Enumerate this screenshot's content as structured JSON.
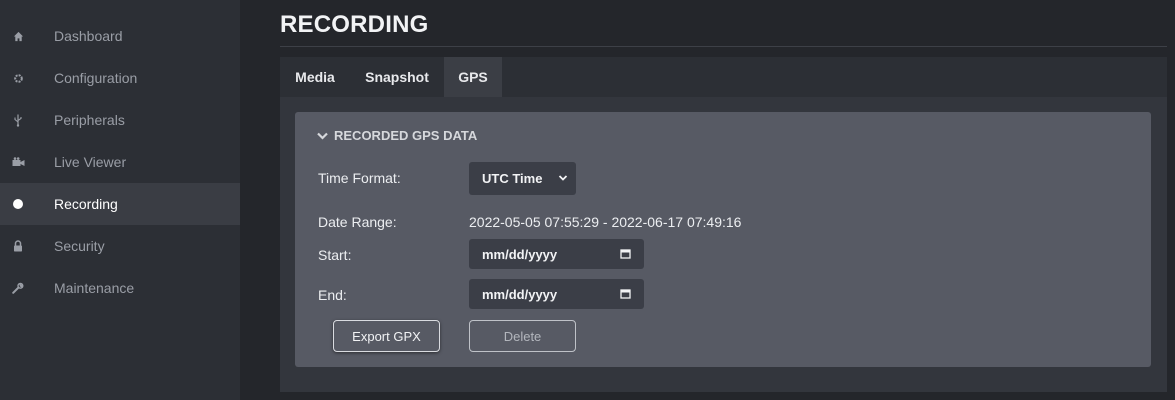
{
  "sidebar": {
    "items": [
      {
        "label": "Dashboard",
        "icon": "home-icon"
      },
      {
        "label": "Configuration",
        "icon": "gear-icon"
      },
      {
        "label": "Peripherals",
        "icon": "usb-icon"
      },
      {
        "label": "Live Viewer",
        "icon": "video-camera-icon"
      },
      {
        "label": "Recording",
        "icon": "record-dot-icon",
        "active": true
      },
      {
        "label": "Security",
        "icon": "lock-icon"
      },
      {
        "label": "Maintenance",
        "icon": "wrench-icon"
      }
    ]
  },
  "page": {
    "title": "RECORDING"
  },
  "tabs": [
    {
      "label": "Media"
    },
    {
      "label": "Snapshot"
    },
    {
      "label": "GPS",
      "active": true
    }
  ],
  "gps": {
    "section_title": "RECORDED GPS DATA",
    "time_format_label": "Time Format:",
    "time_format_value": "UTC Time",
    "date_range_label": "Date Range:",
    "date_range_value": "2022-05-05 07:55:29 - 2022-06-17 07:49:16",
    "start_label": "Start:",
    "start_value": "mm/dd/yyyy",
    "end_label": "End:",
    "end_value": "mm/dd/yyyy",
    "export_label": "Export GPX",
    "delete_label": "Delete"
  },
  "colors": {
    "background": "#24262b",
    "sidebar": "#2c2f35",
    "card": "#575a64",
    "input": "#3b3e47"
  }
}
